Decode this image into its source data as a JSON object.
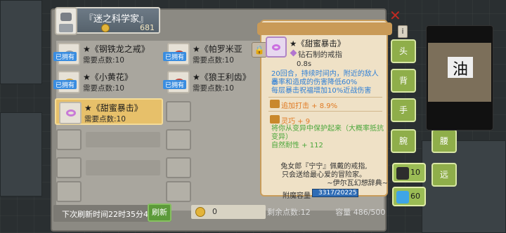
{
  "header": {
    "title": "『迷之科学家』",
    "gold": "681"
  },
  "slots": [
    {
      "name": "★《钢铁龙之戒》",
      "need": "需要点数:10",
      "owned": "已拥有",
      "col": 0,
      "row": 0,
      "ring": "gray"
    },
    {
      "name": "★《帕罗米亚",
      "need": "需要点数:10",
      "owned": "已拥有",
      "col": 1,
      "row": 0,
      "ring": "red"
    },
    {
      "name": "★《小黄花》",
      "need": "需要点数:10",
      "owned": "已拥有",
      "col": 0,
      "row": 1,
      "ring": "gold"
    },
    {
      "name": "★《狼王利齿》",
      "need": "需要点数:10",
      "owned": "已拥有",
      "col": 1,
      "row": 1,
      "ring": "red"
    },
    {
      "name": "★《甜蜜暴击》",
      "need": "需要点数:10",
      "owned": "",
      "col": 0,
      "row": 2,
      "ring": "pink",
      "selected": true
    }
  ],
  "footer": {
    "refresh_timer": "下次刷新时间22时35分40",
    "refresh_button": "刷新",
    "coins": "0",
    "points": "剩余点数:12",
    "capacity": "容量 486/500"
  },
  "tooltip": {
    "name": "★《甜蜜暴击》",
    "subtitle": "钻石制的戒指",
    "speed": "0.8s",
    "desc1": "20回合，持续时间内，附近的敌人暴",
    "desc2": "击率和造成的伤害降低60%",
    "desc3": "每层暴击祝福增加10%近战伤害",
    "stat1": "追加打击 + 8.9%",
    "stat2": "灵巧 + 9",
    "stat3a": "将你从变异中保护起来（大概率抵抗",
    "stat3b": "变异）",
    "stat4": "自然耐性 + 112",
    "flavor1": "兔女郎『宁宁』佩戴的戒指,",
    "flavor2": "只会送给最心爱的冒险家。",
    "flavor3": "~伊尔瓦幻想辞典~",
    "cap_label": "附魔容量",
    "cap_value": "3317/20225",
    "cap_fraction": 0.164
  },
  "equipment": {
    "head": "头",
    "back": "背",
    "hand": "手",
    "wrist": "腕",
    "waist": "腰",
    "far": "远"
  },
  "resources": {
    "hero": "10",
    "gem": "60"
  },
  "colors": {
    "accent": "#c89c5b",
    "blue_text": "#2f7fd6",
    "orange_text": "#e07a23",
    "green_text": "#4aa63a"
  }
}
